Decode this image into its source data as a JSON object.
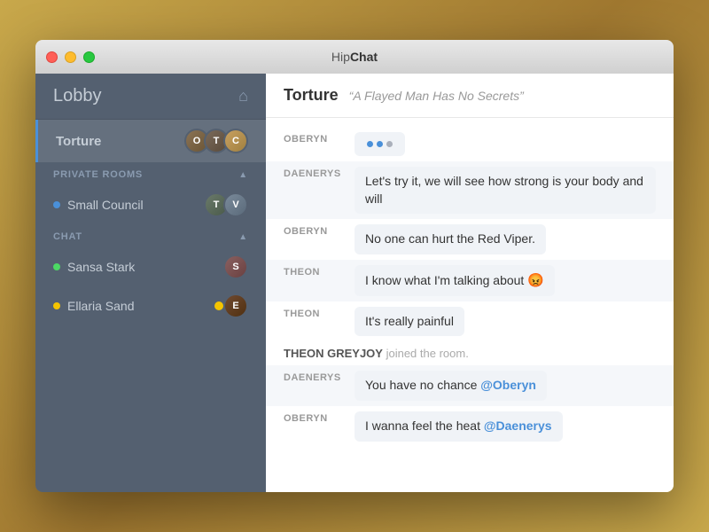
{
  "titlebar": {
    "title_plain": "Hip",
    "title_bold": "Chat",
    "buttons": [
      "close",
      "minimize",
      "maximize"
    ]
  },
  "sidebar": {
    "lobby_label": "Lobby",
    "rooms_section": "PRIVATE ROOMS",
    "chat_section": "CHAT",
    "active_room": "Torture",
    "rooms": [
      {
        "name": "Torture",
        "active": true,
        "avatars": [
          "oberyn",
          "tyrion",
          "cersei"
        ]
      },
      {
        "name": "Small Council",
        "active": false,
        "dot": "blue",
        "avatars": [
          "tywin",
          "varys"
        ]
      }
    ],
    "chats": [
      {
        "name": "Sansa Stark",
        "dot": "green",
        "avatar": "sansa",
        "notification": false
      },
      {
        "name": "Ellaria Sand",
        "dot": "yellow",
        "avatar": "ellaria",
        "notification": true
      }
    ]
  },
  "chat": {
    "room_name": "Torture",
    "room_desc": "“A Flayed Man Has No Secrets”",
    "messages": [
      {
        "id": "typing",
        "sender": "OBERYN",
        "type": "typing"
      },
      {
        "id": "m1",
        "sender": "DAENERYS",
        "text": "Let’s try it, we will see how strong is your body and will",
        "type": "bubble"
      },
      {
        "id": "m2",
        "sender": "OBERYN",
        "text": "No one can hurt the Red Viper.",
        "type": "bubble"
      },
      {
        "id": "m3",
        "sender": "THEON",
        "text": "I know what I’m talking about 😡",
        "type": "bubble"
      },
      {
        "id": "m4",
        "sender": "THEON",
        "text": "It’s really painful",
        "type": "bubble"
      },
      {
        "id": "sys1",
        "type": "system",
        "actor": "THEON GREYJOY",
        "action": "joined the room."
      },
      {
        "id": "m5",
        "sender": "DAENERYS",
        "text": "You have no chance ",
        "mention": "@Oberyn",
        "type": "bubble-mention"
      },
      {
        "id": "m6",
        "sender": "OBERYN",
        "text": "I wanna feel the heat ",
        "mention": "@Daenerys",
        "type": "bubble-mention"
      }
    ]
  }
}
